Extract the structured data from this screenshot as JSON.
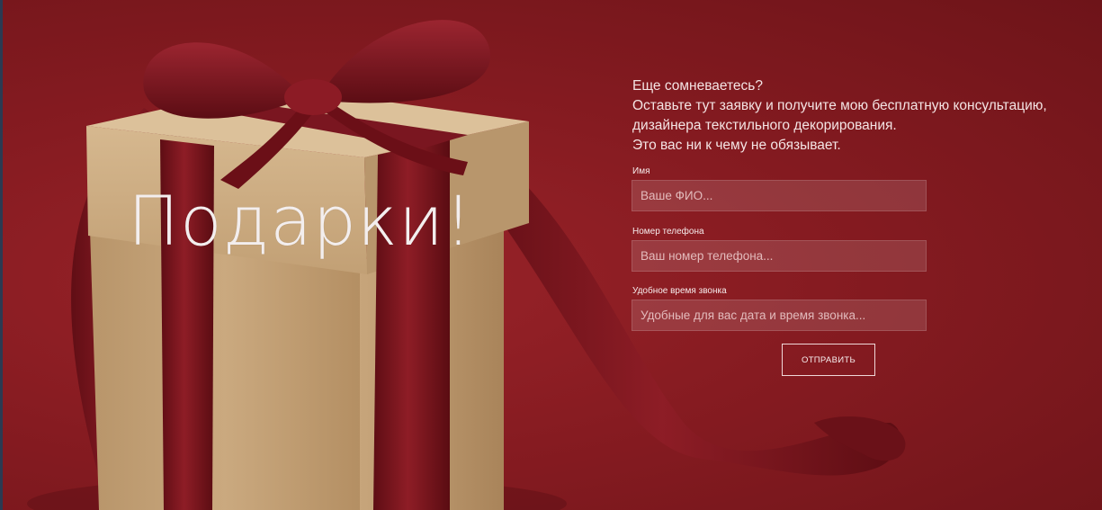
{
  "hero": {
    "title": "Подарки!"
  },
  "lead": {
    "lines": [
      "Еще сомневаетесь?",
      "Оставьте тут заявку и получите мою бесплатную консультацию,",
      "дизайнера текстильного декорирования.",
      "Это вас ни к чему не обязывает."
    ]
  },
  "form": {
    "name": {
      "label": "Имя",
      "placeholder": "Ваше ФИО...",
      "value": ""
    },
    "phone": {
      "label": "Номер телефона",
      "placeholder": "Ваш номер телефона...",
      "value": ""
    },
    "call_time": {
      "label": "Удобное время звонка",
      "placeholder": "Удобные для вас дата и время звонка...",
      "value": ""
    },
    "submit_label": "ОТПРАВИТЬ"
  },
  "colors": {
    "background": "#8a1c22",
    "ribbon": "#7d141c",
    "box": "#c9a87e",
    "text": "#f4e4e4"
  }
}
